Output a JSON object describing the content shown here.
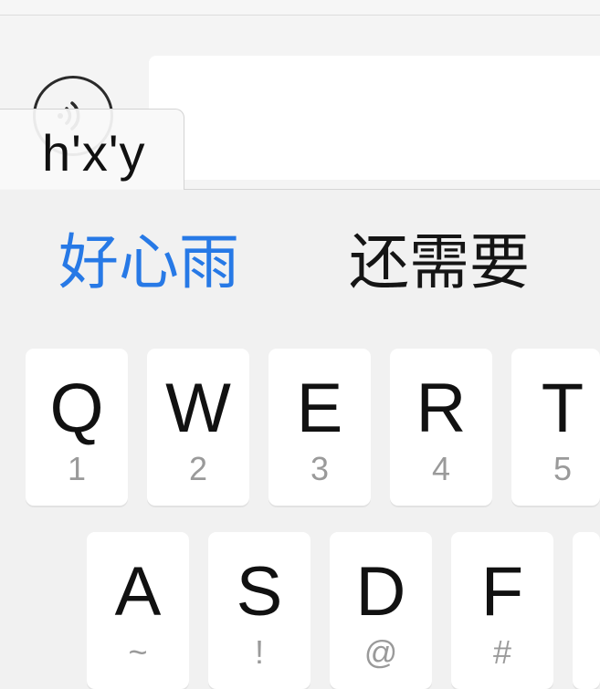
{
  "composition": {
    "text": "h'x'y"
  },
  "candidates": [
    "好心雨",
    "还需要"
  ],
  "keyboard": {
    "row1": [
      {
        "letter": "Q",
        "sub": "1"
      },
      {
        "letter": "W",
        "sub": "2"
      },
      {
        "letter": "E",
        "sub": "3"
      },
      {
        "letter": "R",
        "sub": "4"
      },
      {
        "letter": "T",
        "sub": "5"
      }
    ],
    "row2": [
      {
        "letter": "A",
        "sub": "~"
      },
      {
        "letter": "S",
        "sub": "!"
      },
      {
        "letter": "D",
        "sub": "@"
      },
      {
        "letter": "F",
        "sub": "#"
      },
      {
        "letter": "",
        "sub": ""
      }
    ]
  },
  "colors": {
    "selected_candidate": "#2779e6",
    "keyboard_background": "#f1f1f1",
    "key_background": "#ffffff"
  },
  "icons": {
    "voice": "voice-wave-icon"
  }
}
